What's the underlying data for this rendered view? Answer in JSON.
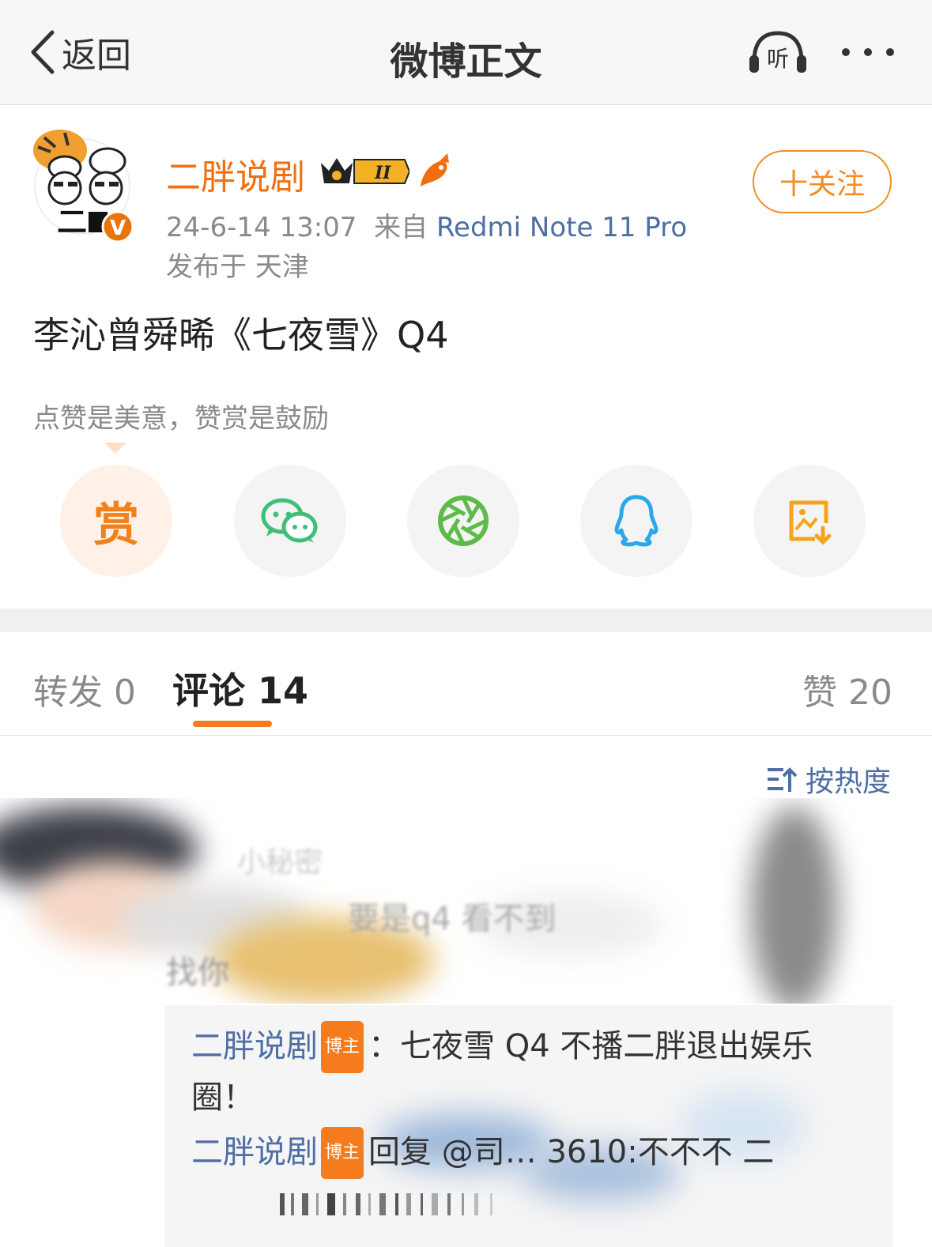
{
  "nav": {
    "back_label": "返回",
    "title": "微博正文",
    "listen_label": "听"
  },
  "author": {
    "name": "二胖说剧",
    "timestamp": "24-6-14 13:07",
    "via": "来自",
    "device": "Redmi Note 11 Pro",
    "location": "发布于 天津",
    "follow_label": "十关注",
    "verified_badge": "V",
    "avatar_text": "二"
  },
  "post": {
    "text": "李沁曾舜晞《七夜雪》Q4"
  },
  "reward": {
    "hint": "点赞是美意，赞赏是鼓励",
    "items": [
      {
        "name": "reward",
        "icon": "reward-icon",
        "label": "赏",
        "color": "#f0821c"
      },
      {
        "name": "wechat",
        "icon": "wechat-icon",
        "color": "#3fbe7a"
      },
      {
        "name": "moments",
        "icon": "moments-icon",
        "color": "#5dbb4a"
      },
      {
        "name": "qq",
        "icon": "qq-icon",
        "color": "#2aa8ea"
      },
      {
        "name": "save-image",
        "icon": "save-image-icon",
        "color": "#f4a41c"
      }
    ]
  },
  "tabs": {
    "repost": "转发 0",
    "comment": "评论 14",
    "like": "赞 20",
    "accent": "#f57b1c"
  },
  "sort": {
    "label": "按热度"
  },
  "comment": {
    "name_visible": "小秘密",
    "text_visible": "要是q4 看不到",
    "text_line2": "找你"
  },
  "replies": [
    {
      "name": "二胖说剧",
      "tag": "博主",
      "text": "：七夜雪 Q4 不播二胖退出娱乐圈！"
    },
    {
      "name": "二胖说剧",
      "tag": "博主",
      "prefix": "回复",
      "text": "@司… 3610:不不不 二"
    }
  ],
  "colors": {
    "orange": "#f26e0e",
    "link": "#4e6ea5",
    "gray": "#8a8a8a"
  }
}
